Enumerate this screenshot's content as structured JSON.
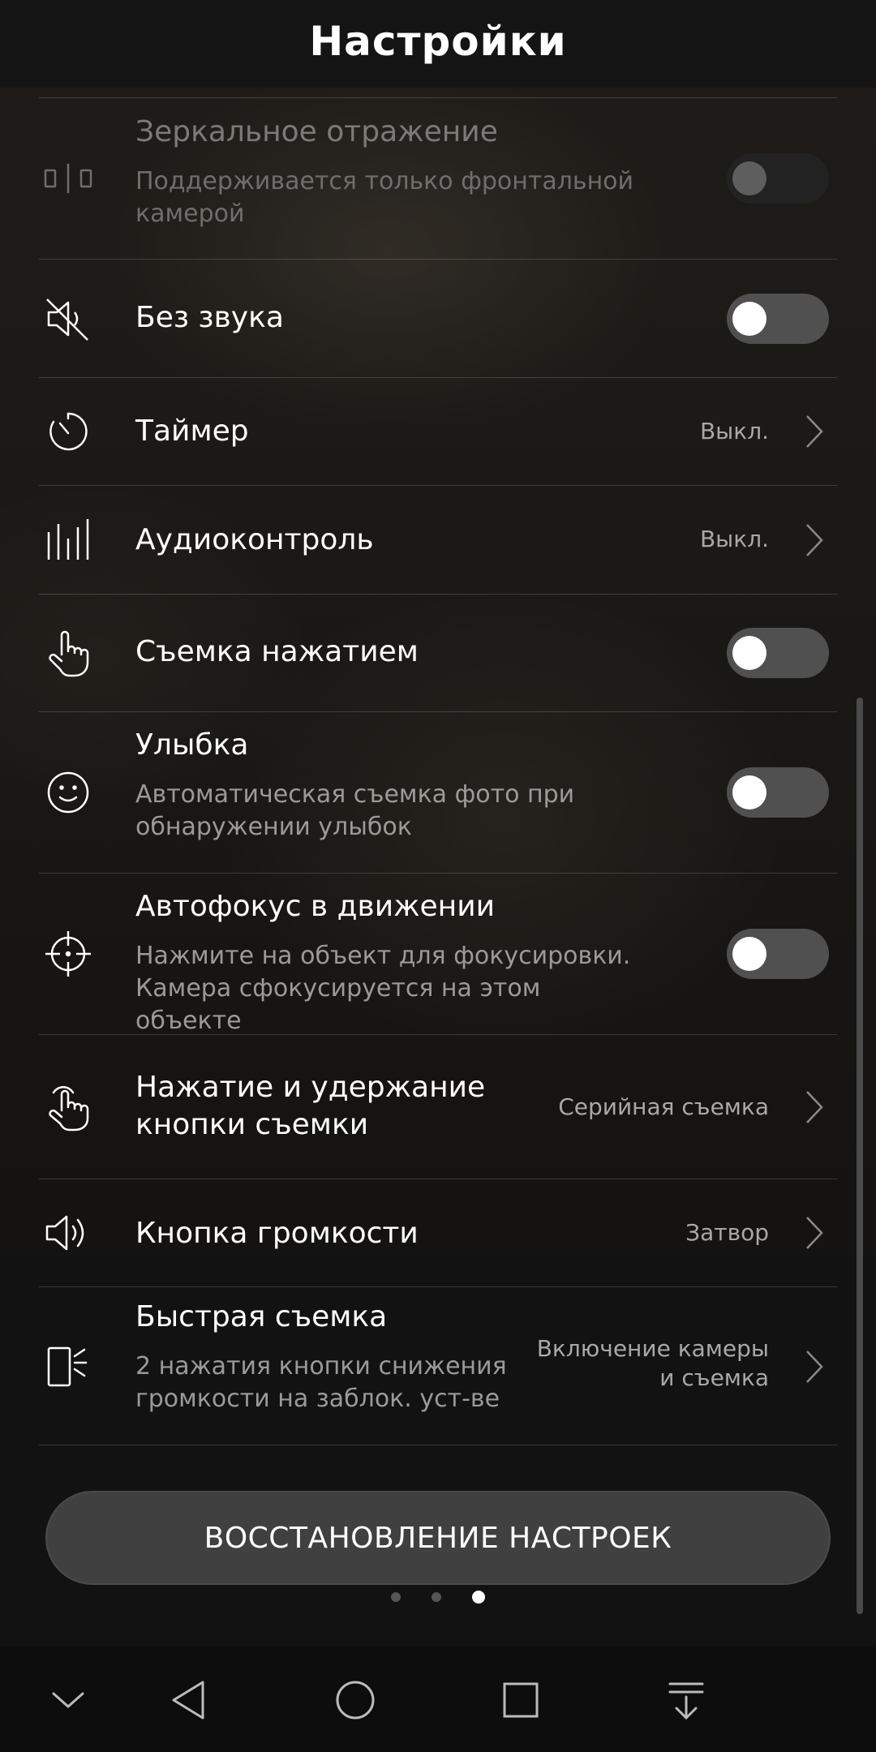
{
  "header": {
    "title": "Настройки"
  },
  "settings": {
    "mirror": {
      "title": "Зеркальное отражение",
      "subtitle": "Поддерживается только фронтальной камерой",
      "icon": "mirror-icon",
      "state": "disabled-off"
    },
    "mute": {
      "title": "Без звука",
      "icon": "speaker-muted-icon",
      "state": "off"
    },
    "timer": {
      "title": "Таймер",
      "value": "Выкл.",
      "icon": "timer-icon"
    },
    "audio_control": {
      "title": "Аудиоконтроль",
      "value": "Выкл.",
      "icon": "audio-bars-icon"
    },
    "touch_capture": {
      "title": "Съемка нажатием",
      "icon": "hand-tap-icon",
      "state": "off"
    },
    "smile": {
      "title": "Улыбка",
      "subtitle": "Автоматическая съемка фото при обнаружении улыбок",
      "icon": "smile-icon",
      "state": "off"
    },
    "tracking_af": {
      "title": "Автофокус в движении",
      "subtitle": "Нажмите на объект для фокусировки. Камера сфокусируется на этом объекте",
      "icon": "crosshair-icon",
      "state": "off"
    },
    "hold_shutter": {
      "title": "Нажатие и удержание кнопки съемки",
      "value": "Серийная съемка",
      "icon": "hand-hold-icon"
    },
    "volume_key": {
      "title": "Кнопка громкости",
      "value": "Затвор",
      "icon": "speaker-icon"
    },
    "quick_snap": {
      "title": "Быстрая съемка",
      "subtitle": "2 нажатия кнопки снижения громкости на заблок. уст-ве",
      "value": "Включение камеры и съемка",
      "icon": "phone-flash-icon"
    }
  },
  "restore_button": {
    "label": "ВОССТАНОВЛЕНИЕ НАСТРОЕК"
  },
  "page_indicator": {
    "count": 3,
    "active_index": 2
  },
  "navbar": {
    "icons": [
      "chevron-down-icon",
      "back-icon",
      "home-icon",
      "recents-icon",
      "notifications-pull-icon"
    ]
  },
  "colors": {
    "background": "#121212",
    "toggle_track": "#505050",
    "toggle_knob": "#ffffff",
    "secondary_text": "#9a9a9a"
  }
}
